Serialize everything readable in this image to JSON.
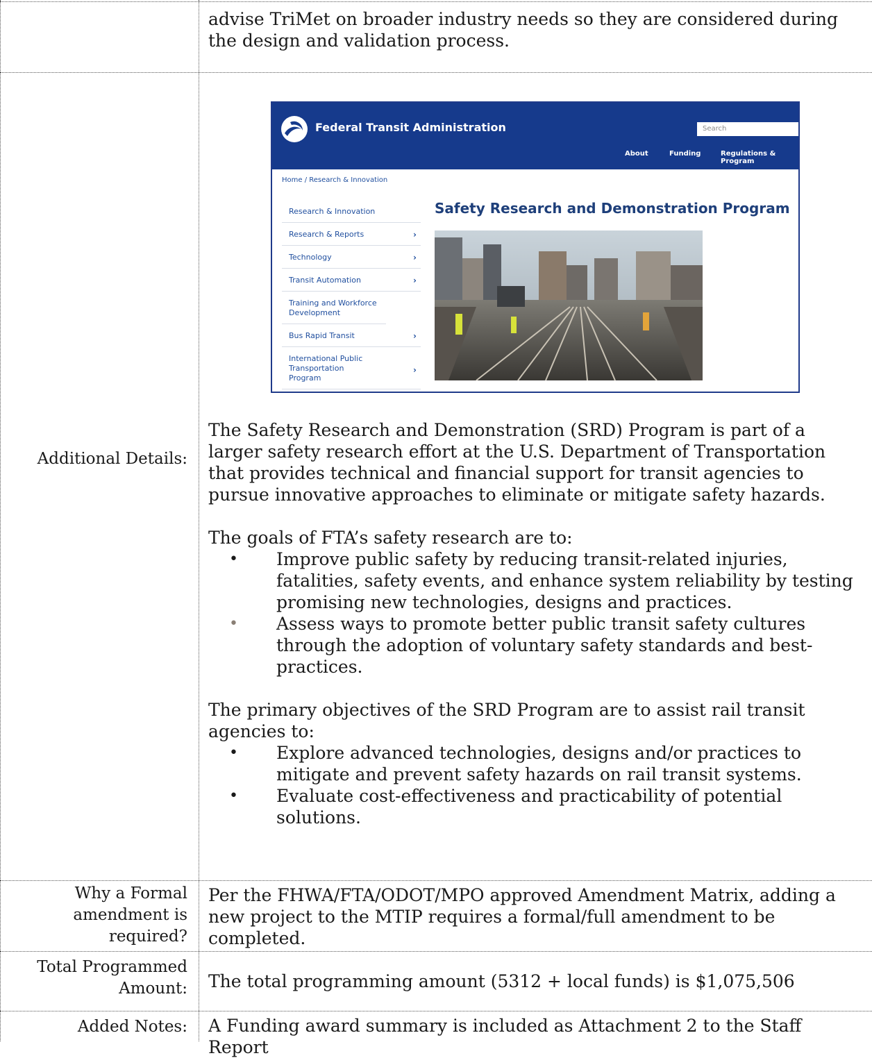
{
  "intro_text": "advise TriMet on broader industry needs so they are considered during the design and validation process.",
  "additional_details": {
    "label": "Additional Details:",
    "screenshot": {
      "site_title": "Federal Transit Administration",
      "search_placeholder": "Search",
      "nav": [
        "About",
        "Funding",
        "Regulations & Program"
      ],
      "breadcrumb": "Home  /  Research & Innovation",
      "sidebar": [
        {
          "label": "Research & Innovation",
          "chevron": false
        },
        {
          "label": "Research & Reports",
          "chevron": true
        },
        {
          "label": "Technology",
          "chevron": true
        },
        {
          "label": "Transit Automation",
          "chevron": true
        },
        {
          "label": "Training and Workforce Development",
          "chevron": false
        },
        {
          "label": "Bus Rapid Transit",
          "chevron": true
        },
        {
          "label": "International Public Transportation Program",
          "chevron": true
        }
      ],
      "page_heading": "Safety Research and Demonstration Program",
      "brand_color": "#163a8c"
    },
    "para1": "The Safety Research and Demonstration (SRD) Program is part of a larger safety research effort at the U.S. Department of Transportation that provides technical and financial support for transit agencies to pursue innovative approaches to eliminate or mitigate safety hazards.",
    "goals_intro": "The goals of FTA’s safety research are to:",
    "goals": [
      "Improve public safety by reducing transit-related injuries, fatalities, safety events, and enhance system reliability by testing promising new technologies, designs and practices.",
      "Assess ways to promote better public transit safety cultures through the adoption of voluntary safety standards and best-practices."
    ],
    "objectives_intro": "The primary objectives of the SRD Program are to assist rail transit agencies to:",
    "objectives": [
      "Explore advanced technologies, designs and/or practices to mitigate and prevent safety hazards on rail transit systems.",
      "Evaluate cost-effectiveness and practicability of potential solutions."
    ]
  },
  "why_formal": {
    "label": "Why a Formal amendment is required?",
    "text": "Per the FHWA/FTA/ODOT/MPO approved Amendment Matrix, adding a new project to the MTIP requires a formal/full amendment to be completed."
  },
  "total_programmed": {
    "label": "Total Programmed Amount:",
    "text": "The total programming amount (5312 + local funds) is $1,075,506"
  },
  "added_notes": {
    "label": "Added Notes:",
    "text": "A Funding award summary is included as Attachment 2 to the Staff Report"
  }
}
